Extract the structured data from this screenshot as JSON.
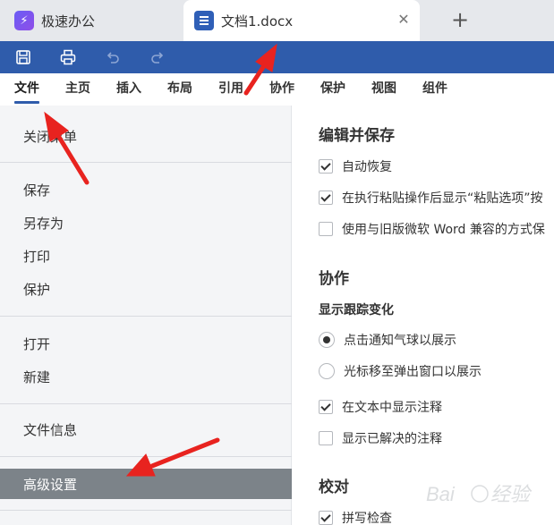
{
  "tabs": {
    "app_tab_label": "极速办公",
    "doc_tab_label": "文档1.docx",
    "close_glyph": "✕",
    "add_glyph": "+"
  },
  "quick_toolbar": {
    "icons": [
      "save-icon",
      "print-icon",
      "undo-icon",
      "redo-icon"
    ],
    "accent_color": "#2f5cab"
  },
  "menu": {
    "items": [
      "文件",
      "主页",
      "插入",
      "布局",
      "引用",
      "协作",
      "保护",
      "视图",
      "组件"
    ],
    "active": "文件"
  },
  "left_panel": {
    "close_menu": "关闭菜单",
    "group1": [
      "保存",
      "另存为",
      "打印",
      "保护"
    ],
    "group2": [
      "打开",
      "新建"
    ],
    "group3": [
      "文件信息"
    ],
    "selected": "高级设置"
  },
  "settings": {
    "section_edit_save": "编辑并保存",
    "autorecover": {
      "label": "自动恢复",
      "checked": true
    },
    "paste_options": {
      "label": "在执行粘贴操作后显示“粘贴选项”按",
      "checked": true
    },
    "legacy_word": {
      "label": "使用与旧版微软 Word 兼容的方式保",
      "checked": false
    },
    "section_collab": "协作",
    "track_changes_title": "显示跟踪变化",
    "balloon": {
      "label": "点击通知气球以展示",
      "checked": true
    },
    "hover_popup": {
      "label": "光标移至弹出窗口以展示",
      "checked": false
    },
    "show_comments": {
      "label": "在文本中显示注释",
      "checked": true
    },
    "show_resolved": {
      "label": "显示已解决的注释",
      "checked": false
    },
    "section_proofing": "校对",
    "spellcheck": {
      "label": "拼写检查",
      "checked": true
    }
  },
  "annotation_color": "#e8231f"
}
